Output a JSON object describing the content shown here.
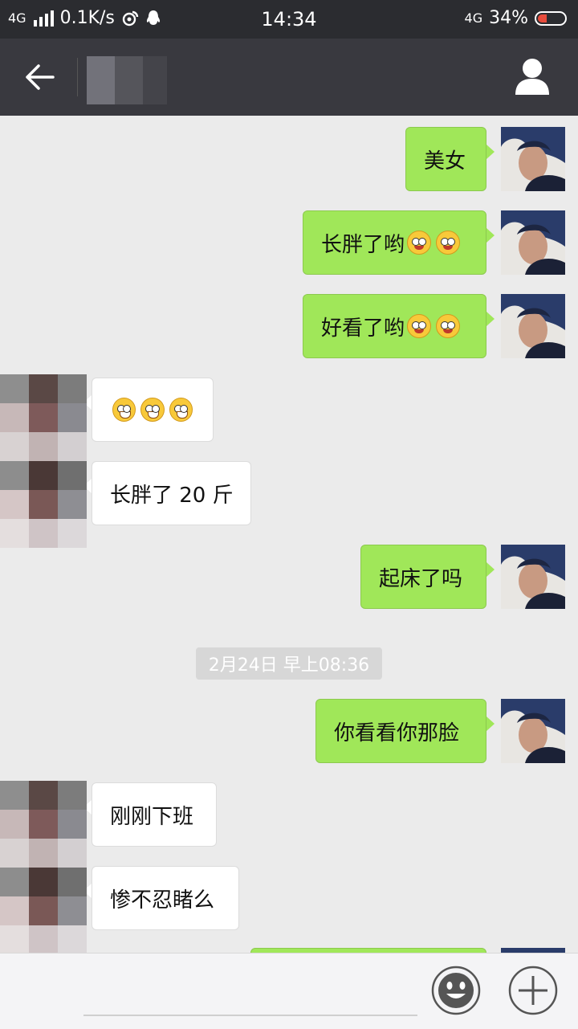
{
  "status_bar": {
    "network_left": "4G",
    "speed": "0.1K/s",
    "time": "14:34",
    "network_right": "4G",
    "battery": "34%",
    "battery_level": 0.34
  },
  "header": {
    "back_icon": "arrow-left-icon",
    "profile_icon": "person-icon"
  },
  "messages": [
    {
      "side": "me",
      "text": "美女",
      "emoji": []
    },
    {
      "side": "me",
      "text": "长胖了哟",
      "emoji": [
        "blush",
        "blush"
      ]
    },
    {
      "side": "me",
      "text": "好看了哟",
      "emoji": [
        "blush",
        "blush"
      ]
    },
    {
      "side": "them",
      "text": "",
      "emoji": [
        "grin",
        "grin",
        "grin"
      ]
    },
    {
      "side": "them",
      "text": "长胖了 20 斤",
      "emoji": []
    },
    {
      "side": "me",
      "text": "起床了吗",
      "emoji": []
    },
    {
      "side": "me",
      "text": "你看看你那脸",
      "emoji": []
    },
    {
      "side": "them",
      "text": "刚刚下班",
      "emoji": []
    },
    {
      "side": "them",
      "text": "惨不忍睹么",
      "emoji": []
    }
  ],
  "timestamp": "2月24日 早上08:36",
  "input_bar": {
    "emoji_icon": "smiley-icon",
    "plus_icon": "plus-icon"
  },
  "colors": {
    "my_bubble": "#a0e759",
    "their_bubble": "#ffffff",
    "header_bg": "#39393f",
    "chat_bg": "#ebebeb"
  }
}
